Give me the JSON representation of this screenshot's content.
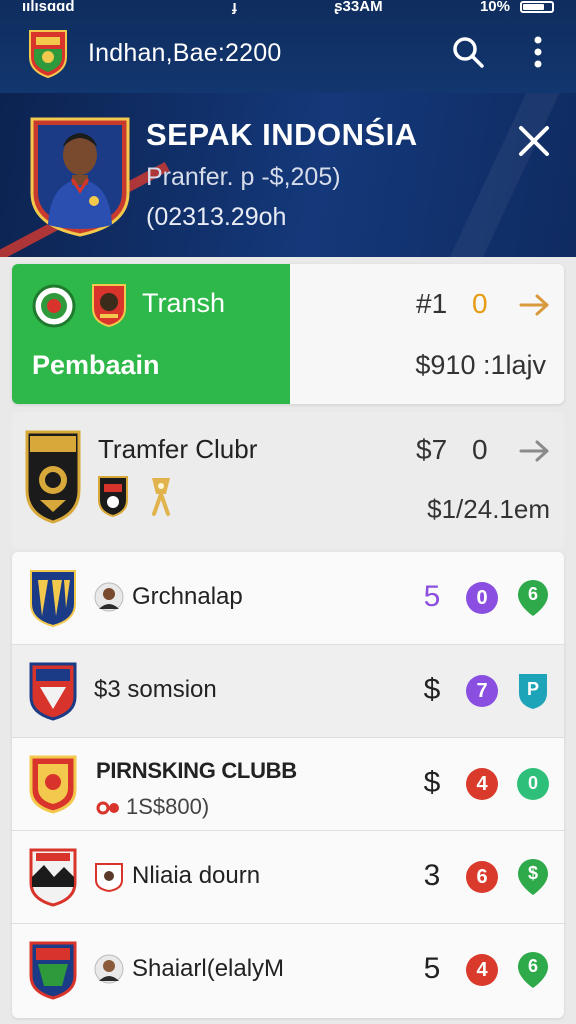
{
  "status_bar": {
    "left": "ıılısɑɑd",
    "mid": "ɟ",
    "time": "ʂ33AM",
    "battery": "10%"
  },
  "app_bar": {
    "title": "Indhan,Bae:2200"
  },
  "hero": {
    "name": "SEPAK INDONŚIA",
    "subtitle": "Pranfer. p -$,205)",
    "date": "(02313.29oh"
  },
  "transfer_card": {
    "title": "Transh",
    "label": "Pembaain",
    "value_a": "#1",
    "value_b": "0",
    "price": "$910 :1lajv"
  },
  "club_card": {
    "title": "Tramfer Clubr",
    "value_a": "$7",
    "value_b": "0",
    "price": "$1/24.1em"
  },
  "rows": [
    {
      "label": "Grchnalap",
      "score": "5",
      "badge": "0",
      "badge_color": "#8a4fe0",
      "pin": "6",
      "pin_color": "#2eaa4a"
    },
    {
      "label": "$3 somsion",
      "score": "$",
      "badge": "7",
      "badge_color": "#8a4fe0",
      "pin": "P",
      "pin_color": "#1ea4b8"
    },
    {
      "label": "PIRNSKING CLUBB",
      "sub": "1S$800)",
      "score": "$",
      "badge": "4",
      "badge_color": "#d93a2b",
      "pin": "0",
      "pin_color": "#2ec07a"
    },
    {
      "label": "Nliaia dourn",
      "score": "3",
      "badge": "6",
      "badge_color": "#d93a2b",
      "pin": "$",
      "pin_color": "#2eaa4a"
    },
    {
      "label": "Shaiarl(elalyM",
      "score": "5",
      "badge": "4",
      "badge_color": "#d93a2b",
      "pin": "6",
      "pin_color": "#2eaa4a"
    }
  ],
  "colors": {
    "header": "#12366f",
    "accent_green": "#2eb84a",
    "orange": "#e69b12"
  }
}
